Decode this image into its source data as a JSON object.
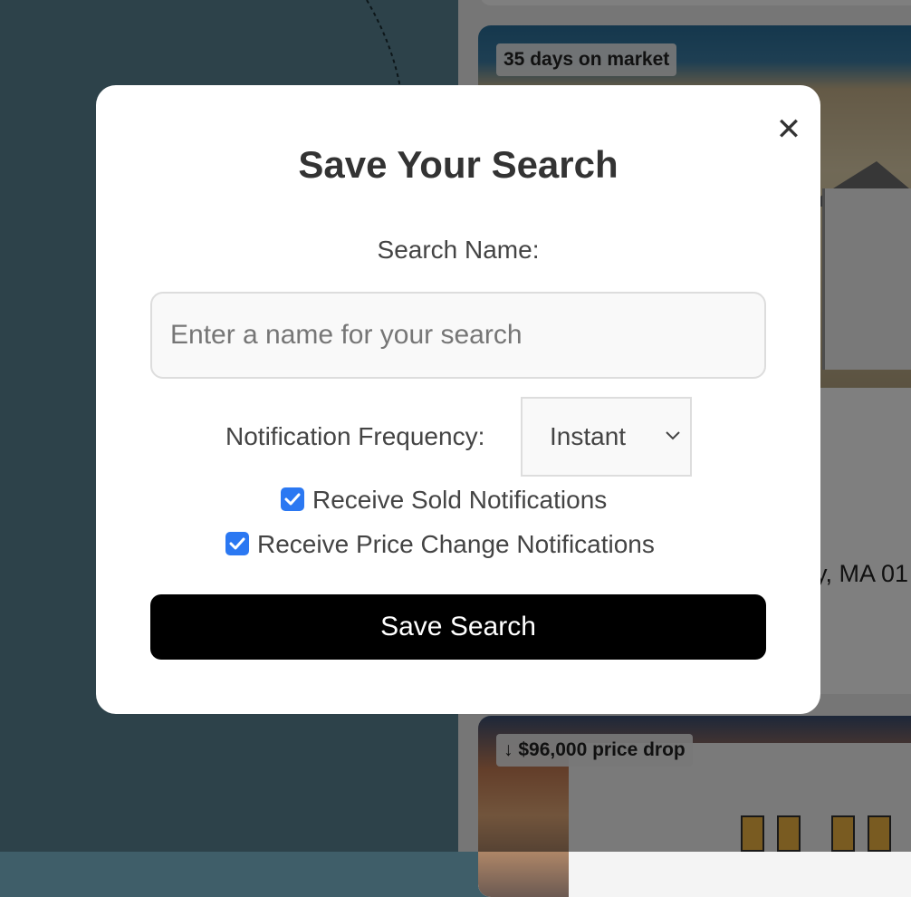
{
  "background": {
    "listings": [
      {
        "badge": "35 days on market",
        "address_fragment": "y, MA 01"
      },
      {
        "badge": "↓ $96,000 price drop"
      }
    ]
  },
  "modal": {
    "title": "Save Your Search",
    "close_icon": "close-icon",
    "search_name_label": "Search Name:",
    "search_name_value": "",
    "search_name_placeholder": "Enter a name for your search",
    "frequency_label": "Notification Frequency:",
    "frequency_selected": "Instant",
    "checkboxes": [
      {
        "label": "Receive Sold Notifications",
        "checked": true
      },
      {
        "label": "Receive Price Change Notifications",
        "checked": true
      }
    ],
    "save_button_label": "Save Search"
  },
  "colors": {
    "accent_checkbox": "#2b78f2",
    "primary_button": "#000000",
    "overlay": "rgba(0,0,0,0.5)"
  }
}
